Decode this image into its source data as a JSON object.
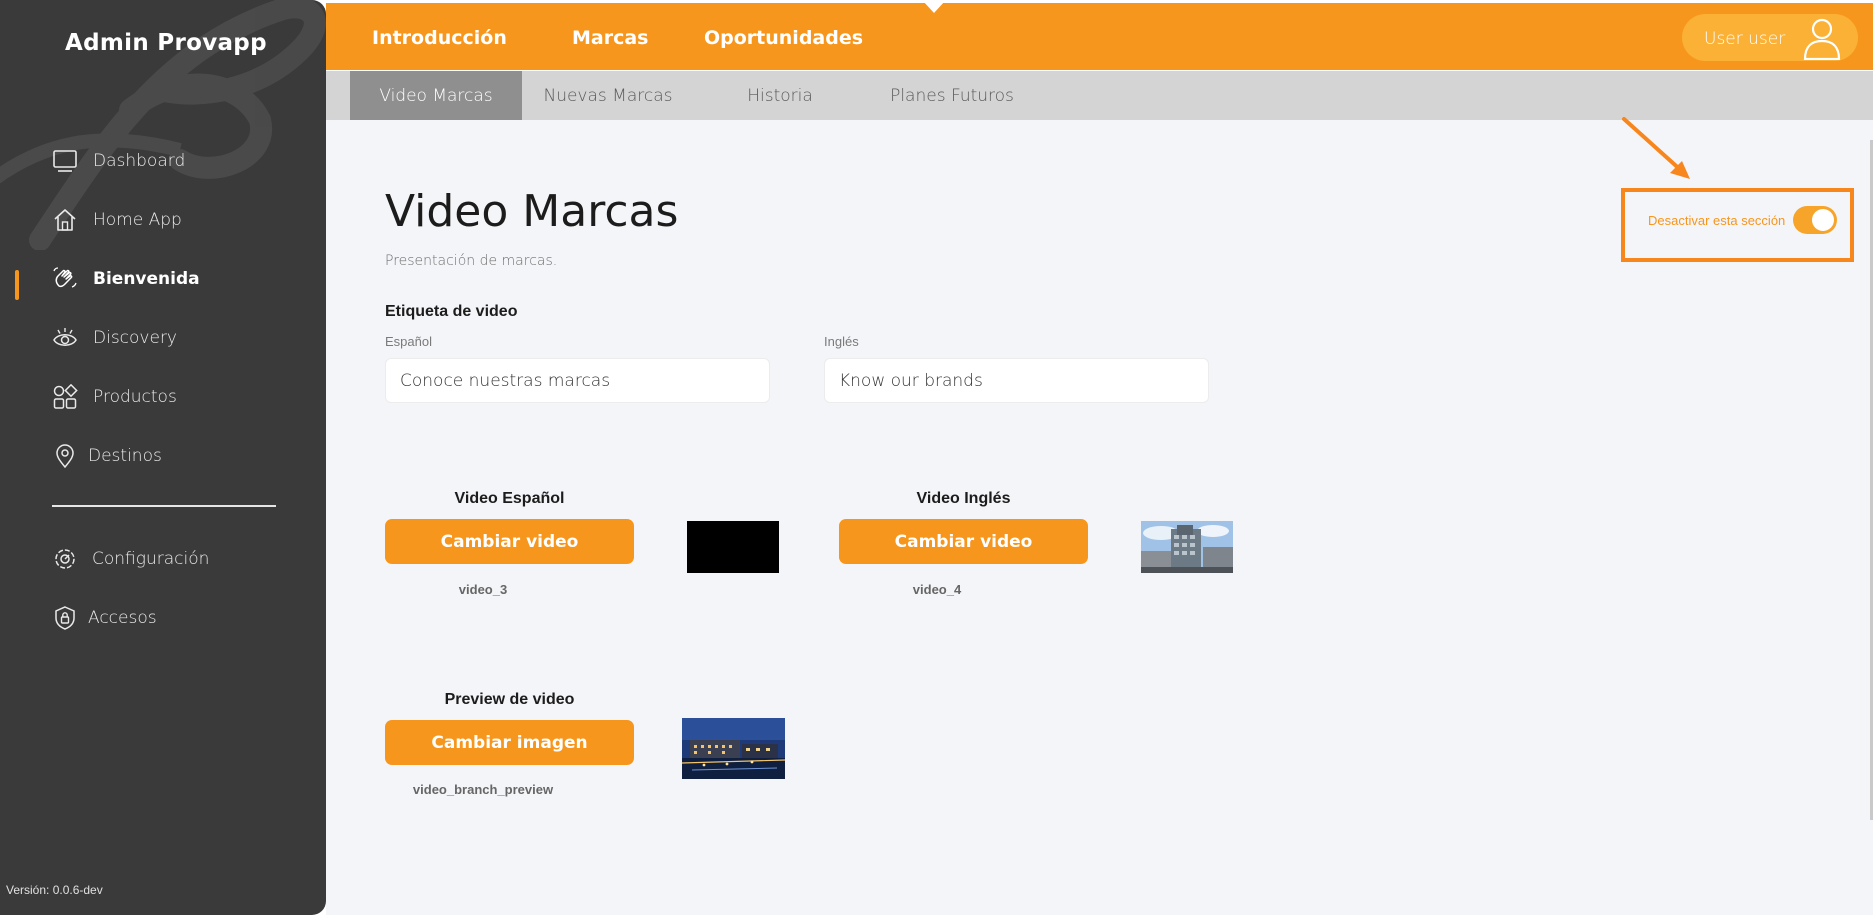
{
  "sidebar": {
    "brand": "Admin Provapp",
    "items": [
      {
        "label": "Dashboard",
        "icon": "monitor-icon"
      },
      {
        "label": "Home App",
        "icon": "house-icon"
      },
      {
        "label": "Bienvenida",
        "icon": "waving-hand-icon",
        "active": true
      },
      {
        "label": "Discovery",
        "icon": "eye-icon"
      },
      {
        "label": "Productos",
        "icon": "grid-shapes-icon"
      },
      {
        "label": "Destinos",
        "icon": "map-pin-icon"
      },
      {
        "label": "Configuración",
        "icon": "settings-icon"
      },
      {
        "label": "Accesos",
        "icon": "shield-lock-icon"
      }
    ],
    "version": "Versión: 0.0.6-dev"
  },
  "topnav": {
    "items": [
      "Introducción",
      "Marcas",
      "Oportunidades"
    ],
    "active": "Marcas",
    "user_label": "User user"
  },
  "subtabs": {
    "items": [
      "Video Marcas",
      "Nuevas Marcas",
      "Historia",
      "Planes Futuros"
    ],
    "active": "Video Marcas"
  },
  "page": {
    "title": "Video Marcas",
    "description": "Presentación de marcas.",
    "toggle_label": "Desactivar esta sección",
    "toggle_on": true
  },
  "video_label": {
    "heading": "Etiqueta de video",
    "es_label": "Español",
    "es_value": "Conoce nuestras marcas",
    "en_label": "Inglés",
    "en_value": "Know our brands"
  },
  "videos": {
    "es": {
      "heading": "Video Español",
      "button": "Cambiar video",
      "file": "video_3"
    },
    "en": {
      "heading": "Video Inglés",
      "button": "Cambiar video",
      "file": "video_4"
    },
    "preview": {
      "heading": "Preview de video",
      "button": "Cambiar imagen",
      "file": "video_branch_preview"
    }
  },
  "colors": {
    "accent": "#f7961d",
    "sidebar": "#3a3a3a",
    "subbar": "#d4d4d4",
    "subtab_active": "#8f8f8f",
    "highlight_box": "#f7861d"
  }
}
